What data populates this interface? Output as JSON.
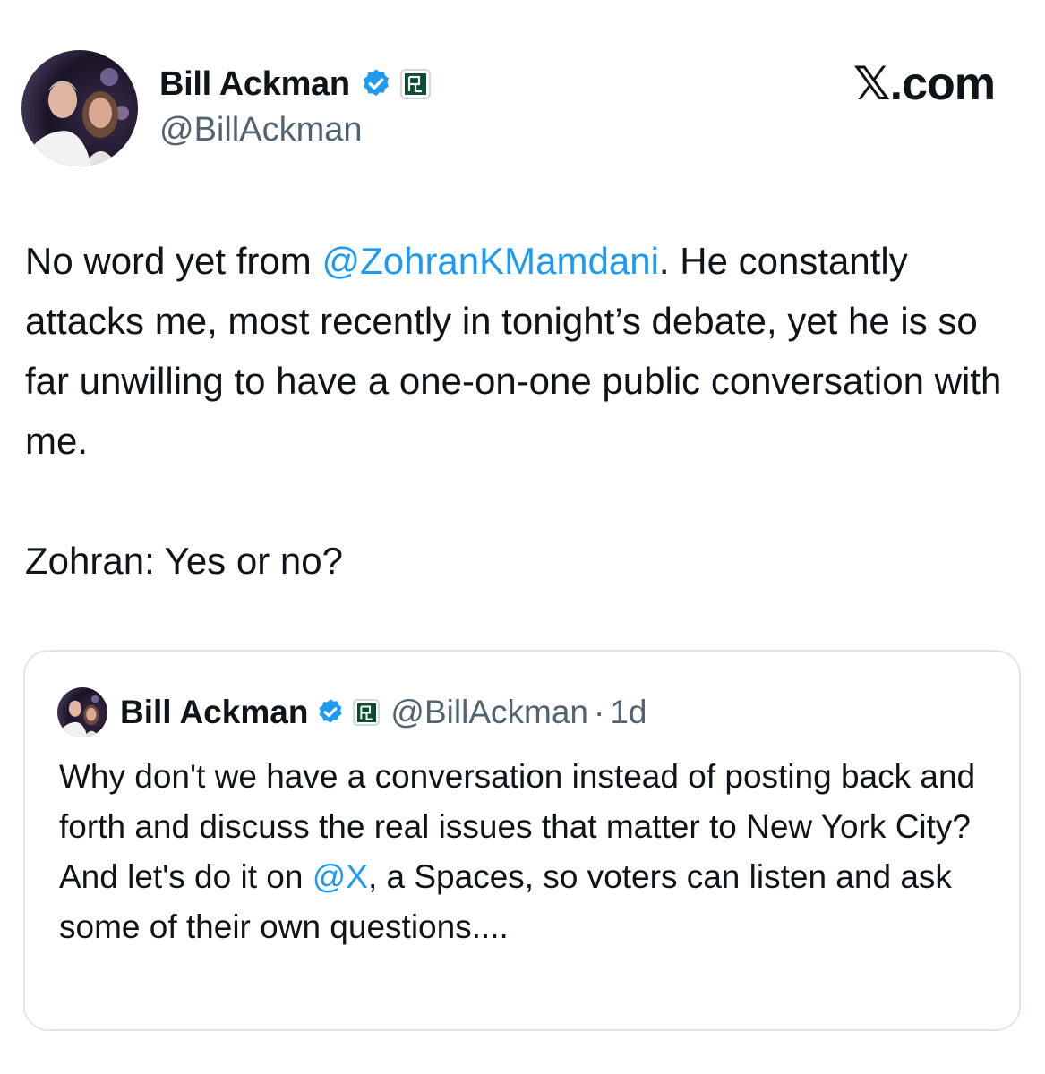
{
  "post": {
    "author_name": "Bill Ackman",
    "author_handle": "@BillAckman",
    "site_label": ".com",
    "text_before_mention": "No word yet from ",
    "mention": "@ZohranKMamdani",
    "text_after_mention": ". He constantly attacks me, most recently in tonight’s debate, yet he is so far unwilling to have a one-on-one public conversation with me.",
    "closing_line": "Zohran:  Yes or no?"
  },
  "quote": {
    "author_name": "Bill Ackman",
    "author_handle": "@BillAckman",
    "separator": "·",
    "time": "1d",
    "text_before_mention": "Why don't we have a conversation instead of posting back and forth and discuss the real issues that matter to New York City?  And let's do it on ",
    "mention": "@X",
    "text_after_mention": ", a Spaces, so voters can listen and ask some of their own questions...."
  },
  "icons": {
    "verified": "verified-badge-icon",
    "affiliation": "pershing-square-affiliate-icon",
    "x_logo": "x-logo-icon"
  },
  "colors": {
    "mention": "#1d9bf0",
    "verified": "#1d9bf0",
    "affiliation": "#0b4d2e",
    "secondary_text": "#536471"
  }
}
